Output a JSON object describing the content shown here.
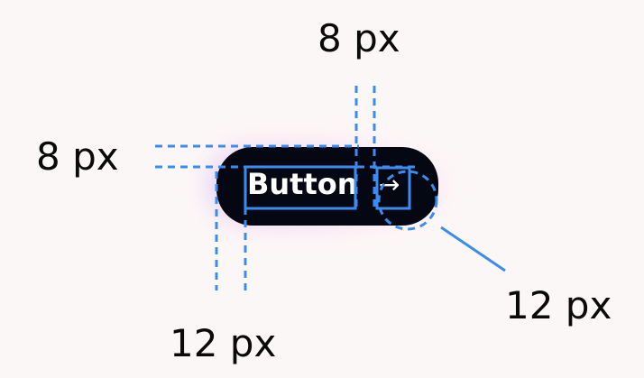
{
  "button": {
    "label": "Button",
    "icon": "arrow-right-icon",
    "arrow_glyph": "→",
    "background_color": "#050812"
  },
  "annotations": {
    "top_gap": "8 px",
    "left_gap": "8 px",
    "bottom_gap": "12 px",
    "right_gap": "12 px"
  },
  "colors": {
    "guide": "#3b8cf0",
    "background": "#fcf7f7",
    "text": "#0a0a0a"
  }
}
